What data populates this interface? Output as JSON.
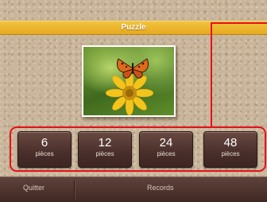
{
  "header": {
    "title": "Puzzle"
  },
  "image": {
    "icon": "butterfly-on-flower-photo"
  },
  "piece_options": [
    {
      "number": "6",
      "unit": "pièces"
    },
    {
      "number": "12",
      "unit": "pièces"
    },
    {
      "number": "24",
      "unit": "pièces"
    },
    {
      "number": "48",
      "unit": "pièces"
    }
  ],
  "footer": {
    "quit_label": "Quitter",
    "records_label": "Records"
  },
  "colors": {
    "title_bar": "#e6a91f",
    "button": "#4b302b",
    "annotation": "#e8101a"
  }
}
